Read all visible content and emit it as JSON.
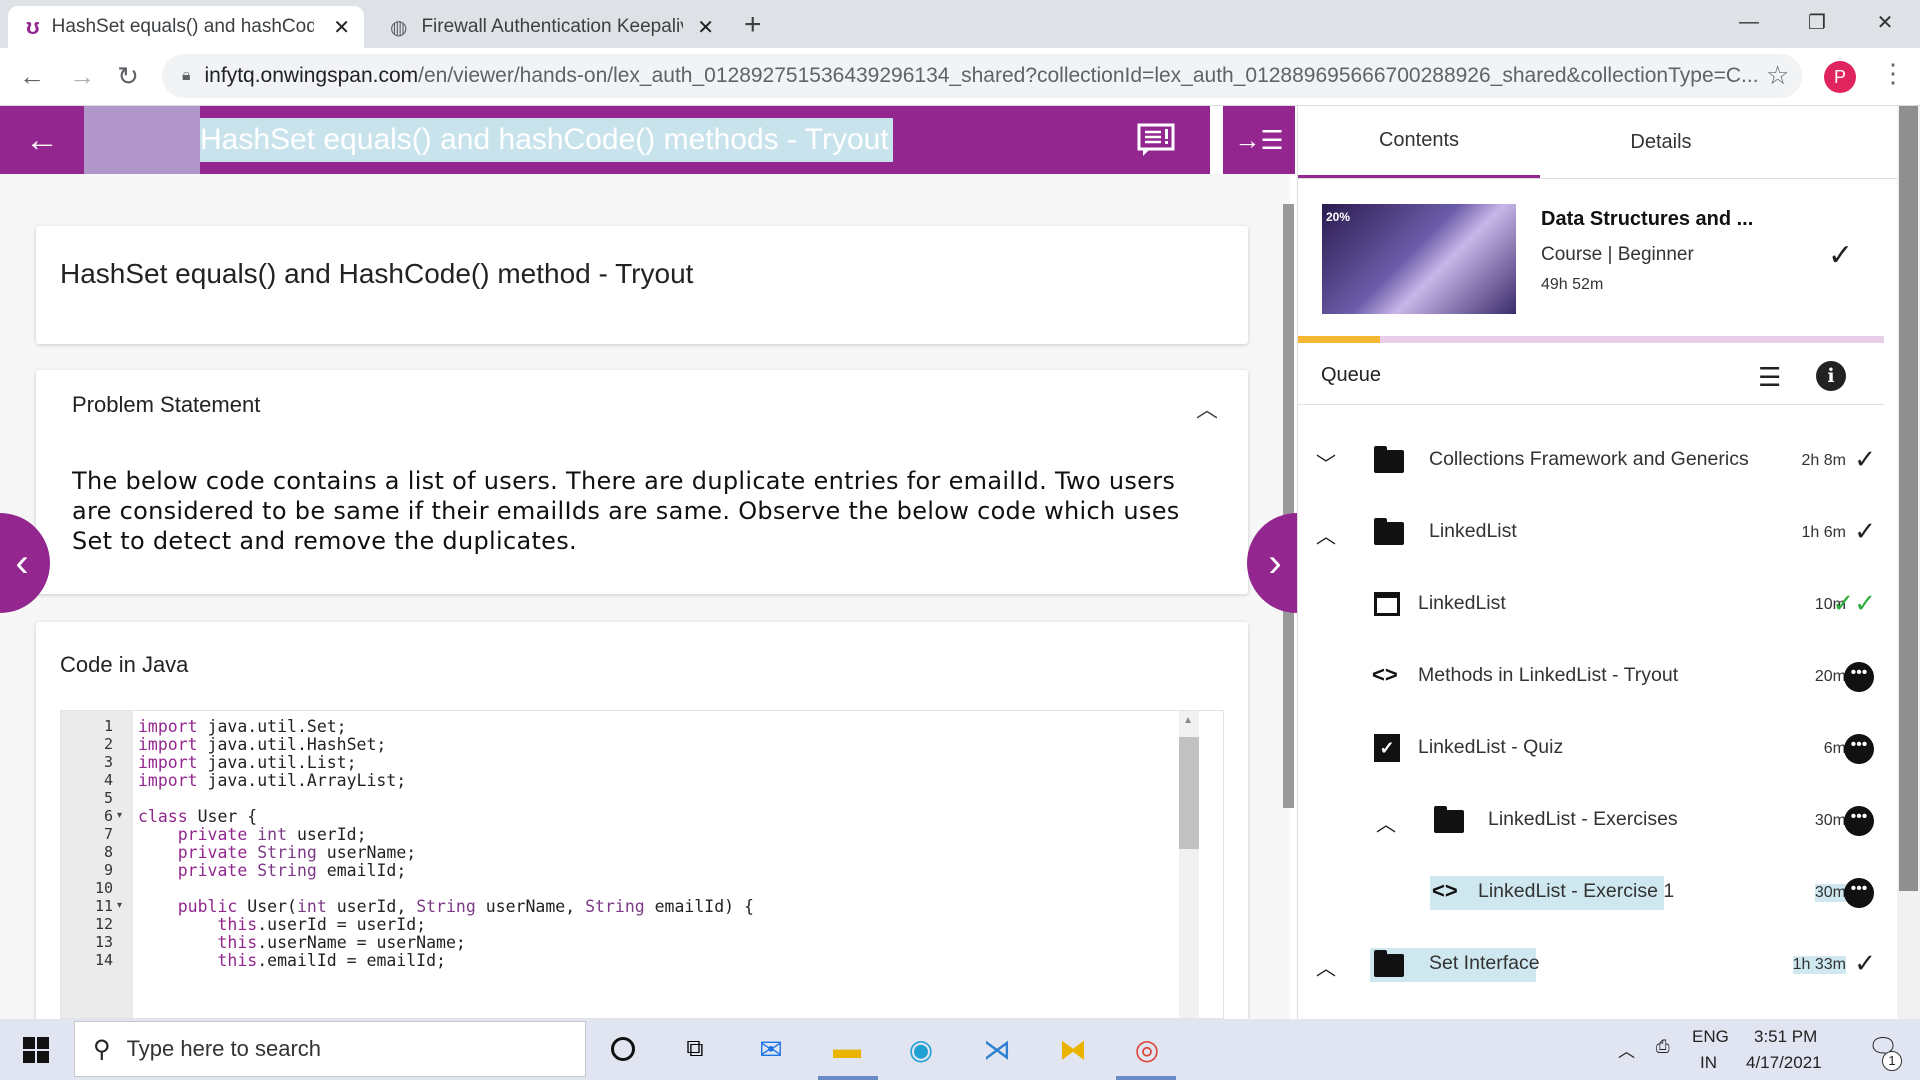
{
  "browser": {
    "tabs": [
      {
        "title": "HashSet equals() and hashCode()",
        "close": "✕"
      },
      {
        "title": "Firewall Authentication Keepalive",
        "close": "✕"
      }
    ],
    "new_tab": "+",
    "url_host": "infytq.onwingspan.com",
    "url_path": "/en/viewer/hands-on/lex_auth_012892751536439296134_shared?collectionId=lex_auth_01288969566670028892​6_shared&collectionType=C...",
    "profile_initial": "P"
  },
  "header": {
    "title": "HashSet equals() and hashCode() methods - Tryout"
  },
  "content": {
    "title": "HashSet equals() and HashCode() method - Tryout",
    "problem_heading": "Problem Statement",
    "problem_text": "The below code contains a list of users. There are duplicate entries for emailId. Two users are considered to be same if their emailIds are same. Observe the below code which uses Set to detect and remove the duplicates.",
    "code_heading": "Code in Java"
  },
  "code_lines": [
    {
      "n": "1",
      "fold": "",
      "text": "import java.util.Set;"
    },
    {
      "n": "2",
      "fold": "",
      "text": "import java.util.HashSet;"
    },
    {
      "n": "3",
      "fold": "",
      "text": "import java.util.List;"
    },
    {
      "n": "4",
      "fold": "",
      "text": "import java.util.ArrayList;"
    },
    {
      "n": "5",
      "fold": "",
      "text": ""
    },
    {
      "n": "6",
      "fold": "▾",
      "text": "class User {"
    },
    {
      "n": "7",
      "fold": "",
      "text": "    private int userId;"
    },
    {
      "n": "8",
      "fold": "",
      "text": "    private String userName;"
    },
    {
      "n": "9",
      "fold": "",
      "text": "    private String emailId;"
    },
    {
      "n": "10",
      "fold": "",
      "text": ""
    },
    {
      "n": "11",
      "fold": "▾",
      "text": "    public User(int userId, String userName, String emailId) {"
    },
    {
      "n": "12",
      "fold": "",
      "text": "        this.userId = userId;"
    },
    {
      "n": "13",
      "fold": "",
      "text": "        this.userName = userName;"
    },
    {
      "n": "14",
      "fold": "",
      "text": "        this.emailId = emailId;"
    }
  ],
  "sidebar": {
    "tab_contents": "Contents",
    "tab_details": "Details",
    "course_title": "Data Structures and ...",
    "course_meta": "Course |  Beginner",
    "course_duration": "49h 52m",
    "course_progress_badge": "20%",
    "progress_fraction": 0.14,
    "queue_label": "Queue",
    "queue": [
      {
        "label": "Collections Framework and Generics",
        "dur": "2h 8m",
        "status": "done"
      },
      {
        "label": "LinkedList",
        "dur": "1h 6m",
        "status": "done"
      },
      {
        "label": "LinkedList",
        "dur": "10m",
        "status": "done-green"
      },
      {
        "label": "Methods in LinkedList - Tryout",
        "dur": "20m",
        "status": "more"
      },
      {
        "label": "LinkedList - Quiz",
        "dur": "6m",
        "status": "more"
      },
      {
        "label": "LinkedList - Exercises",
        "dur": "30m",
        "status": "more"
      },
      {
        "label": "LinkedList - Exercise 1",
        "dur": "30m",
        "status": "more"
      },
      {
        "label": "Set Interface",
        "dur": "1h 33m",
        "status": "done"
      }
    ]
  },
  "taskbar": {
    "search_placeholder": "Type here to search",
    "lang": "ENG",
    "region": "IN",
    "time": "3:51 PM",
    "date": "4/17/2021",
    "notifications": "1"
  },
  "colors": {
    "brand": "#94278f",
    "progress": "#f5b731",
    "check_green": "#2eae3c"
  }
}
